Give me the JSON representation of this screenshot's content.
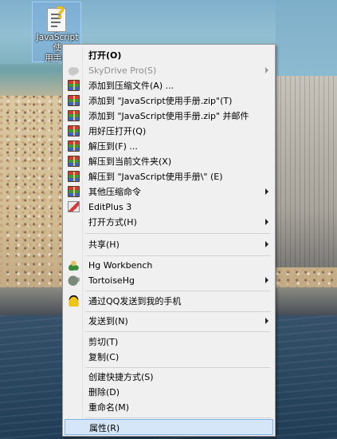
{
  "desktop": {
    "icon_label": "JavaScript使\n用手册"
  },
  "menu": {
    "items": [
      {
        "key": "open",
        "label": "打开(O)",
        "bold": true,
        "icon": "none"
      },
      {
        "key": "skydrive",
        "label": "SkyDrive Pro(S)",
        "disabled": true,
        "submenu": true,
        "icon": "cloud-icon"
      },
      {
        "key": "add-archive",
        "label": "添加到压缩文件(A) ...",
        "icon": "winrar-icon"
      },
      {
        "key": "add-zip",
        "label": "添加到 \"JavaScript使用手册.zip\"(T)",
        "icon": "winrar-icon"
      },
      {
        "key": "add-zip-mail",
        "label": "添加到 \"JavaScript使用手册.zip\" 并邮件",
        "icon": "winrar-icon"
      },
      {
        "key": "open-haozip",
        "label": "用好压打开(Q)",
        "icon": "winrar-icon"
      },
      {
        "key": "extract-to",
        "label": "解压到(F) ...",
        "icon": "winrar-icon"
      },
      {
        "key": "extract-here",
        "label": "解压到当前文件夹(X)",
        "icon": "winrar-icon"
      },
      {
        "key": "extract-folder",
        "label": "解压到 \"JavaScript使用手册\\\" (E)",
        "icon": "winrar-icon"
      },
      {
        "key": "other-compress",
        "label": "其他压缩命令",
        "submenu": true,
        "icon": "winrar-icon"
      },
      {
        "key": "editplus",
        "label": "EditPlus 3",
        "icon": "editplus-icon"
      },
      {
        "key": "open-with",
        "label": "打开方式(H)",
        "submenu": true,
        "icon": "none"
      },
      {
        "key": "share",
        "label": "共享(H)",
        "submenu": true,
        "icon": "none"
      },
      {
        "key": "hg-workbench",
        "label": "Hg Workbench",
        "icon": "hg-icon"
      },
      {
        "key": "tortoisehg",
        "label": "TortoiseHg",
        "submenu": true,
        "icon": "tortoise-icon"
      },
      {
        "key": "qq-send",
        "label": "通过QQ发送到我的手机",
        "icon": "qq-icon"
      },
      {
        "key": "send-to",
        "label": "发送到(N)",
        "submenu": true,
        "icon": "none"
      },
      {
        "key": "cut",
        "label": "剪切(T)",
        "icon": "none"
      },
      {
        "key": "copy",
        "label": "复制(C)",
        "icon": "none"
      },
      {
        "key": "create-shortcut",
        "label": "创建快捷方式(S)",
        "icon": "none"
      },
      {
        "key": "delete",
        "label": "删除(D)",
        "icon": "none"
      },
      {
        "key": "rename",
        "label": "重命名(M)",
        "icon": "none"
      },
      {
        "key": "properties",
        "label": "属性(R)",
        "highlighted": true,
        "icon": "none"
      }
    ]
  }
}
